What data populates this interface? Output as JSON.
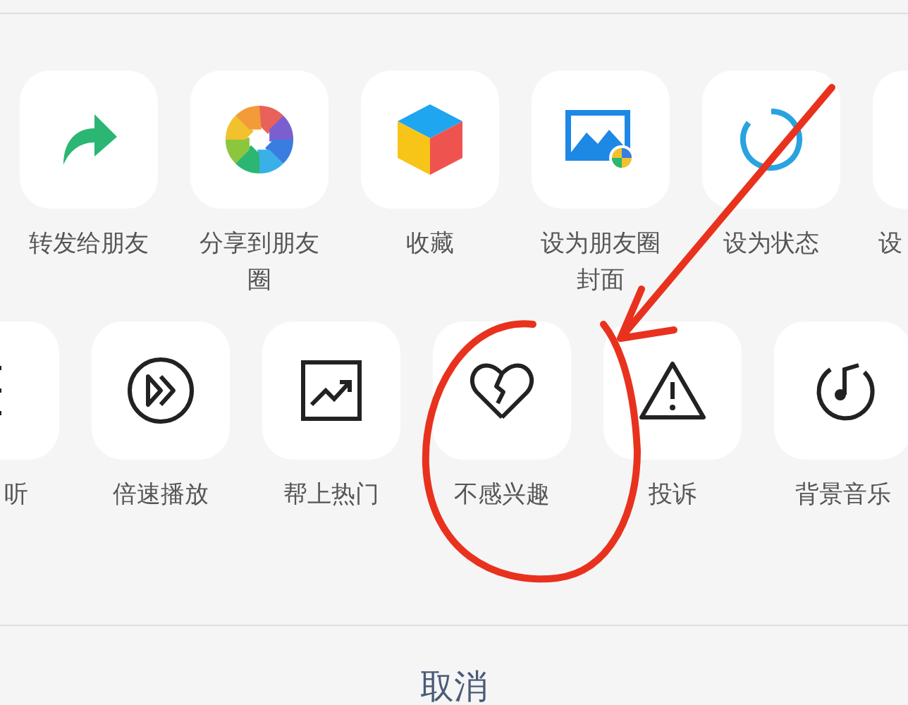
{
  "share_row": [
    {
      "label": "转发给朋友"
    },
    {
      "label": "分享到朋友圈"
    },
    {
      "label": "收藏"
    },
    {
      "label": "设为朋友圈封面"
    },
    {
      "label": "设为状态"
    },
    {
      "label": "设"
    }
  ],
  "action_row": [
    {
      "label": "听"
    },
    {
      "label": "倍速播放"
    },
    {
      "label": "帮上热门"
    },
    {
      "label": "不感兴趣"
    },
    {
      "label": "投诉"
    },
    {
      "label": "背景音乐"
    }
  ],
  "cancel_button": {
    "label": "取消"
  }
}
